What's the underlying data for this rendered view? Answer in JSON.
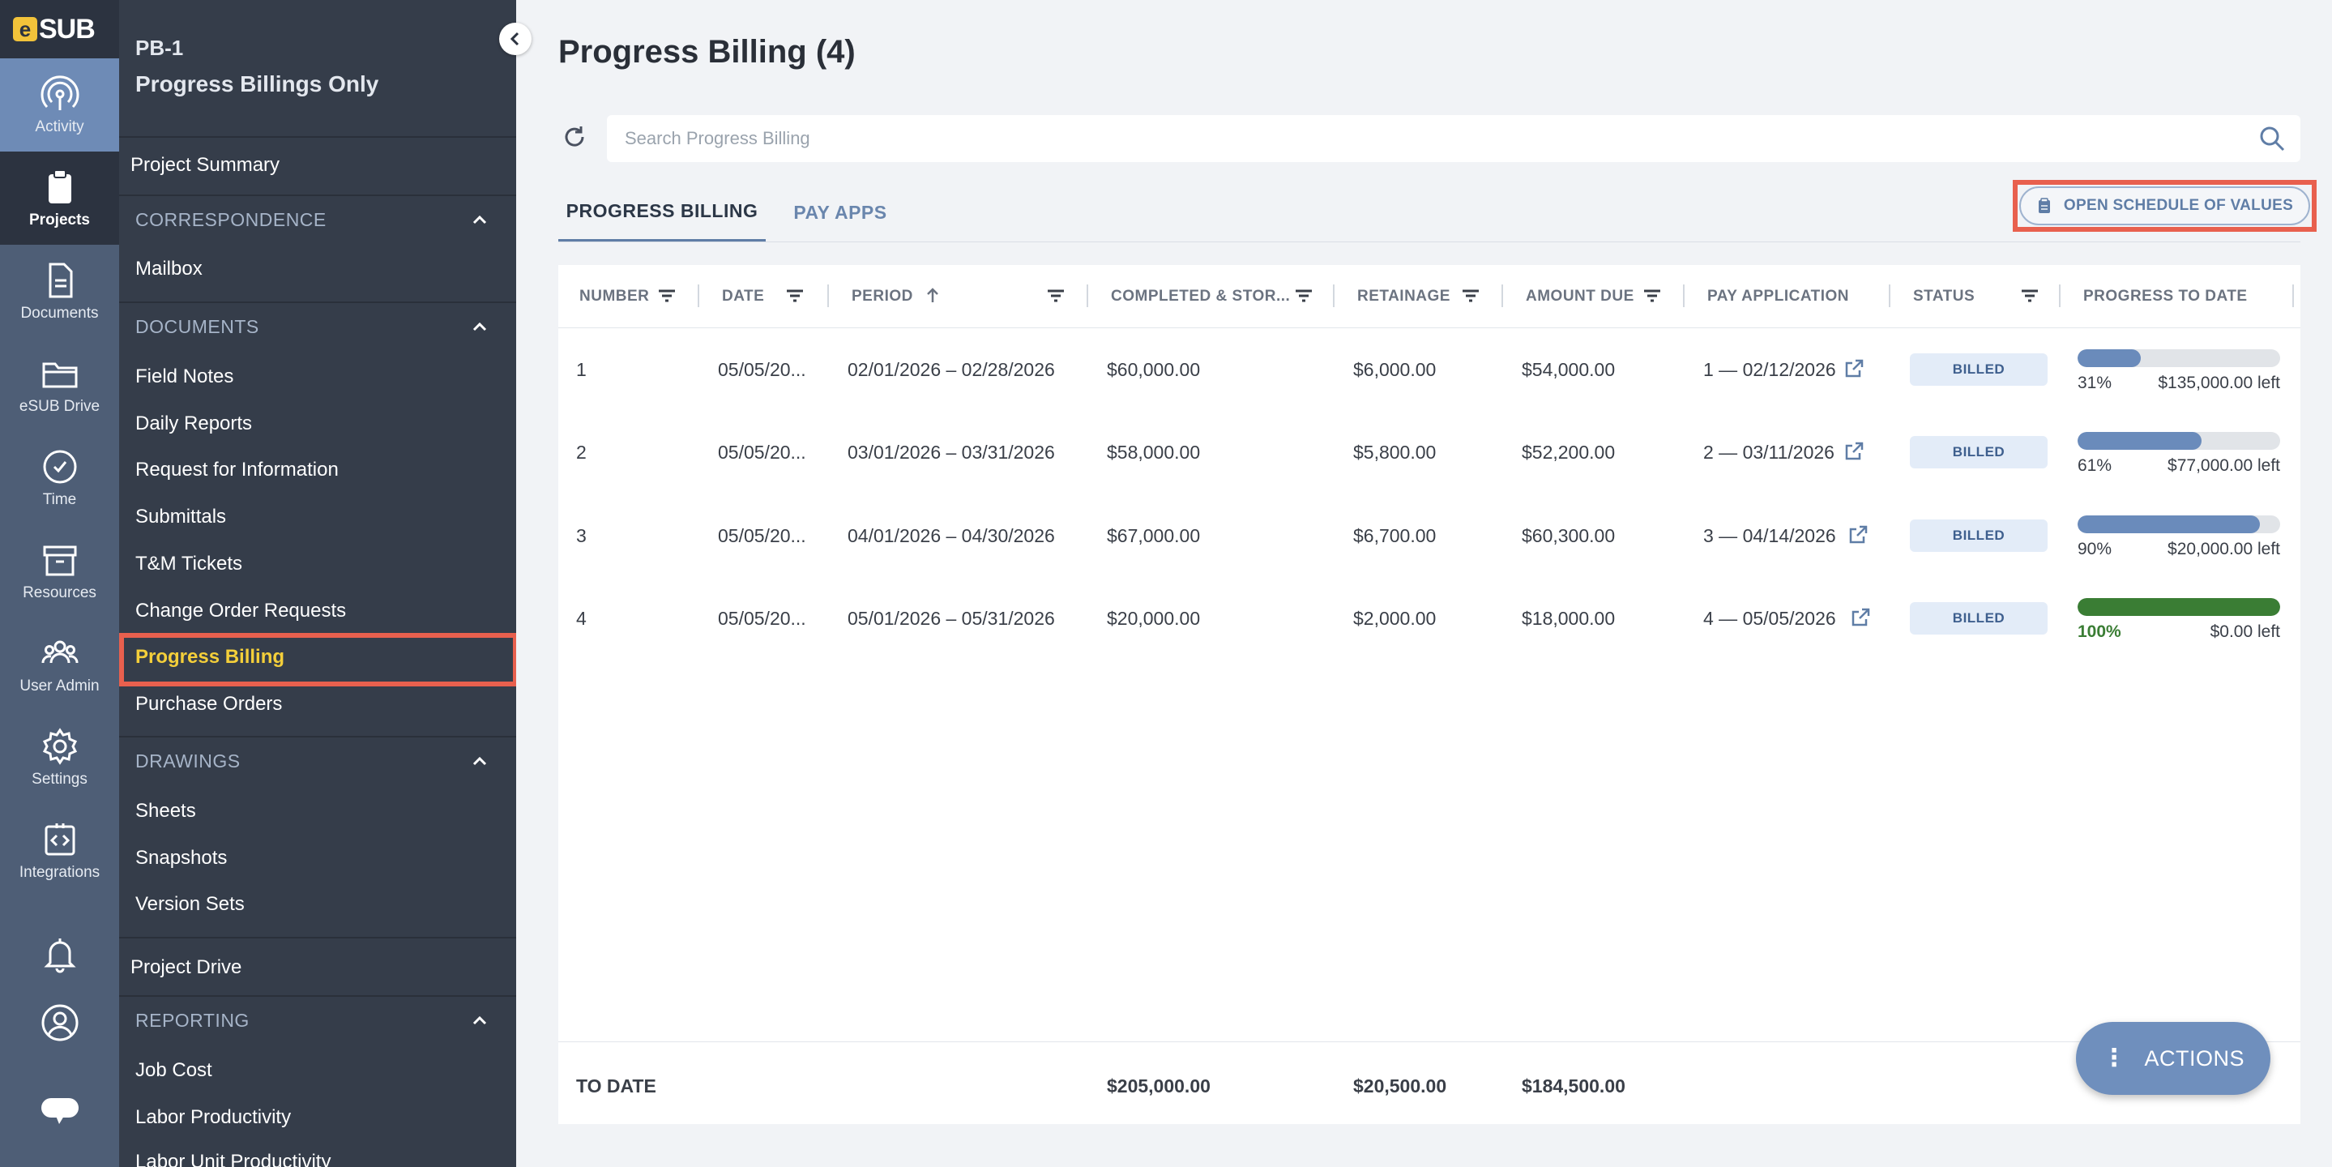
{
  "logo": {
    "e": "e",
    "rest": "SUB"
  },
  "rail": [
    {
      "label": "Activity",
      "icon": "activity-icon",
      "state": "light"
    },
    {
      "label": "Projects",
      "icon": "clipboard-icon",
      "state": "dark"
    },
    {
      "label": "Documents",
      "icon": "document-icon",
      "state": ""
    },
    {
      "label": "eSUB Drive",
      "icon": "folder-icon",
      "state": ""
    },
    {
      "label": "Time",
      "icon": "clock-icon",
      "state": ""
    },
    {
      "label": "Resources",
      "icon": "box-icon",
      "state": ""
    },
    {
      "label": "User Admin",
      "icon": "users-icon",
      "state": ""
    },
    {
      "label": "Settings",
      "icon": "gear-icon",
      "state": ""
    },
    {
      "label": "Integrations",
      "icon": "code-icon",
      "state": ""
    }
  ],
  "sidebar": {
    "project_code": "PB-1",
    "project_name": "Progress Billings Only",
    "project_summary": "Project Summary",
    "correspondence": {
      "title": "CORRESPONDENCE",
      "items": [
        "Mailbox"
      ]
    },
    "documents": {
      "title": "DOCUMENTS",
      "items": [
        "Field Notes",
        "Daily Reports",
        "Request for Information",
        "Submittals",
        "T&M Tickets",
        "Change Order Requests",
        "Progress Billing",
        "Purchase Orders"
      ],
      "active": "Progress Billing"
    },
    "drawings": {
      "title": "DRAWINGS",
      "items": [
        "Sheets",
        "Snapshots",
        "Version Sets"
      ]
    },
    "project_drive": "Project Drive",
    "reporting": {
      "title": "REPORTING",
      "items": [
        "Job Cost",
        "Labor Productivity",
        "Labor Unit Productivity"
      ]
    }
  },
  "main": {
    "title": "Progress Billing (4)",
    "search_placeholder": "Search Progress Billing",
    "tabs": [
      "PROGRESS BILLING",
      "PAY APPS"
    ],
    "active_tab": "PROGRESS BILLING",
    "sov_button": "OPEN SCHEDULE OF VALUES",
    "actions_button": "ACTIONS",
    "accent_color": "#5f7da6",
    "highlight_color": "#e8604e"
  },
  "table": {
    "columns": [
      "NUMBER",
      "DATE",
      "PERIOD",
      "COMPLETED & STOR...",
      "RETAINAGE",
      "AMOUNT DUE",
      "PAY APPLICATION",
      "STATUS",
      "PROGRESS TO DATE"
    ],
    "rows": [
      {
        "number": "1",
        "date": "05/05/20...",
        "period": "02/01/2026 – 02/28/2026",
        "completed": "$60,000.00",
        "retainage": "$6,000.00",
        "amount_due": "$54,000.00",
        "pay_app": "1 — 02/12/2026",
        "status": "BILLED",
        "progress": 0.31,
        "progress_label": "31%",
        "left": "$135,000.00 left"
      },
      {
        "number": "2",
        "date": "05/05/20...",
        "period": "03/01/2026 – 03/31/2026",
        "completed": "$58,000.00",
        "retainage": "$5,800.00",
        "amount_due": "$52,200.00",
        "pay_app": "2 — 03/11/2026",
        "status": "BILLED",
        "progress": 0.61,
        "progress_label": "61%",
        "left": "$77,000.00 left"
      },
      {
        "number": "3",
        "date": "05/05/20...",
        "period": "04/01/2026 – 04/30/2026",
        "completed": "$67,000.00",
        "retainage": "$6,700.00",
        "amount_due": "$60,300.00",
        "pay_app": "3 — 04/14/2026",
        "status": "BILLED",
        "progress": 0.9,
        "progress_label": "90%",
        "left": "$20,000.00 left"
      },
      {
        "number": "4",
        "date": "05/05/20...",
        "period": "05/01/2026 – 05/31/2026",
        "completed": "$20,000.00",
        "retainage": "$2,000.00",
        "amount_due": "$18,000.00",
        "pay_app": "4 — 05/05/2026",
        "status": "BILLED",
        "progress": 1.0,
        "progress_label": "100%",
        "left": "$0.00 left"
      }
    ],
    "footer": {
      "label": "TO DATE",
      "completed": "$205,000.00",
      "retainage": "$20,500.00",
      "amount_due": "$184,500.00"
    }
  }
}
